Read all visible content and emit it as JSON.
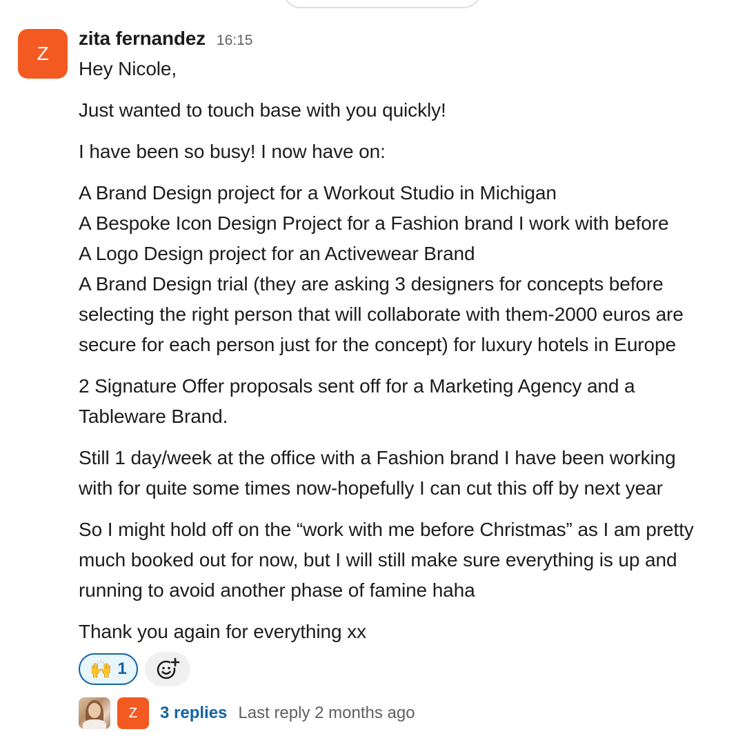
{
  "message": {
    "avatar_letter": "Z",
    "sender": "zita fernandez",
    "time": "16:15",
    "paragraphs": [
      [
        "Hey Nicole,"
      ],
      [
        "Just wanted to touch base with you quickly!"
      ],
      [
        "I have been so busy! I now have on:"
      ],
      [
        "A Brand Design project for a Workout Studio in Michigan",
        "A Bespoke Icon Design Project for a Fashion brand I work with before",
        "A Logo Design project for an Activewear Brand",
        "A Brand Design trial (they are asking 3 designers for concepts before",
        "selecting the right person that will collaborate with them-2000 euros are",
        "secure for each person just for the concept) for luxury hotels in Europe"
      ],
      [
        "2 Signature Offer proposals sent off for a Marketing Agency and a",
        "Tableware Brand."
      ],
      [
        "Still 1 day/week at the office with a Fashion brand I have been working",
        "with for quite some times now-hopefully I can cut this off by next year"
      ],
      [
        "So I might hold off on the “work with me before Christmas” as I am pretty",
        "much booked out for now, but I will still make sure everything is up and",
        "running to avoid another phase of famine haha"
      ],
      [
        "Thank you again for everything xx"
      ]
    ]
  },
  "reactions": [
    {
      "emoji": "🙌",
      "count": "1"
    }
  ],
  "add_reaction_icon": "add-emoji-icon",
  "thread": {
    "avatar_letter": "Z",
    "replies_label": "3 replies",
    "last_reply": "Last reply 2 months ago"
  },
  "colors": {
    "avatar": "#f25a22",
    "link": "#1264a3",
    "reaction_bg": "#e8f5fa",
    "muted": "#616061"
  }
}
